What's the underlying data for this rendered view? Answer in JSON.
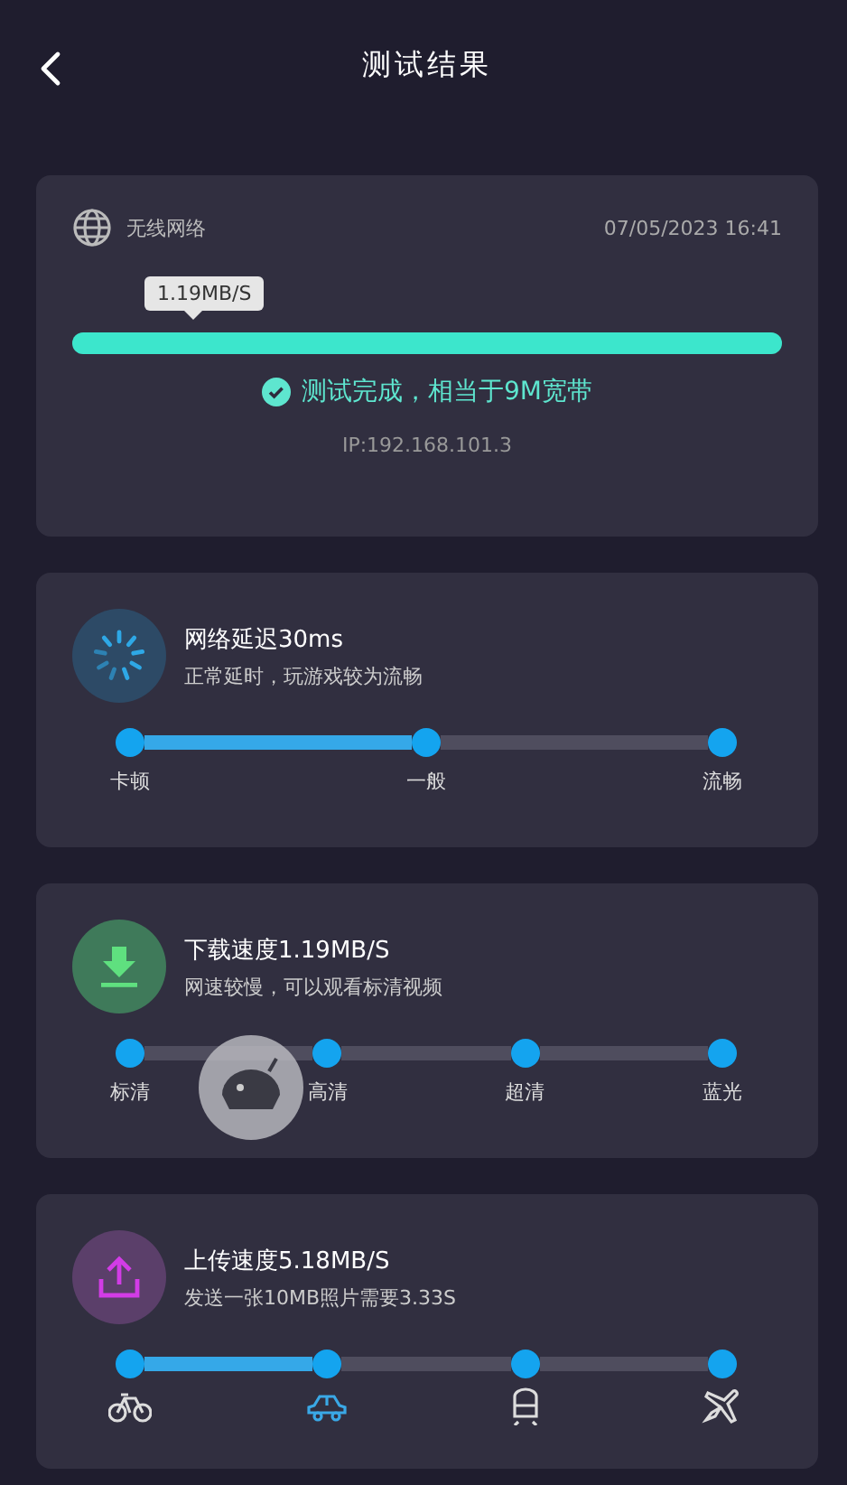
{
  "header": {
    "title": "测试结果"
  },
  "summary": {
    "network": "无线网络",
    "datetime": "07/05/2023 16:41",
    "speed": "1.19MB/S",
    "level": 1.0,
    "status": "测试完成，相当于9M宽带",
    "ip": "IP:192.168.101.3"
  },
  "metrics": [
    {
      "kind": "latency",
      "title": "网络延迟30ms",
      "subtitle": "正常延时，玩游戏较为流畅",
      "segments": [
        {
          "filled": true
        },
        {
          "filled": false
        }
      ],
      "steps": [
        {
          "kind": "text",
          "label": "卡顿"
        },
        {
          "kind": "text",
          "label": "一般"
        },
        {
          "kind": "text",
          "label": "流畅"
        }
      ]
    },
    {
      "kind": "download",
      "title": "下载速度1.19MB/S",
      "subtitle": "网速较慢，可以观看标清视频",
      "segments": [
        {
          "filled": false
        },
        {
          "filled": false
        },
        {
          "filled": false
        }
      ],
      "steps": [
        {
          "kind": "text",
          "label": "标清"
        },
        {
          "kind": "text",
          "label": "高清"
        },
        {
          "kind": "text",
          "label": "超清"
        },
        {
          "kind": "text",
          "label": "蓝光"
        }
      ]
    },
    {
      "kind": "upload",
      "title": "上传速度5.18MB/S",
      "subtitle": "发送一张10MB照片需要3.33S",
      "segments": [
        {
          "filled": true
        },
        {
          "filled": false
        },
        {
          "filled": false
        }
      ],
      "steps": [
        {
          "kind": "bike",
          "selected": false
        },
        {
          "kind": "car",
          "selected": true
        },
        {
          "kind": "train",
          "selected": false
        },
        {
          "kind": "plane",
          "selected": false
        }
      ]
    }
  ]
}
